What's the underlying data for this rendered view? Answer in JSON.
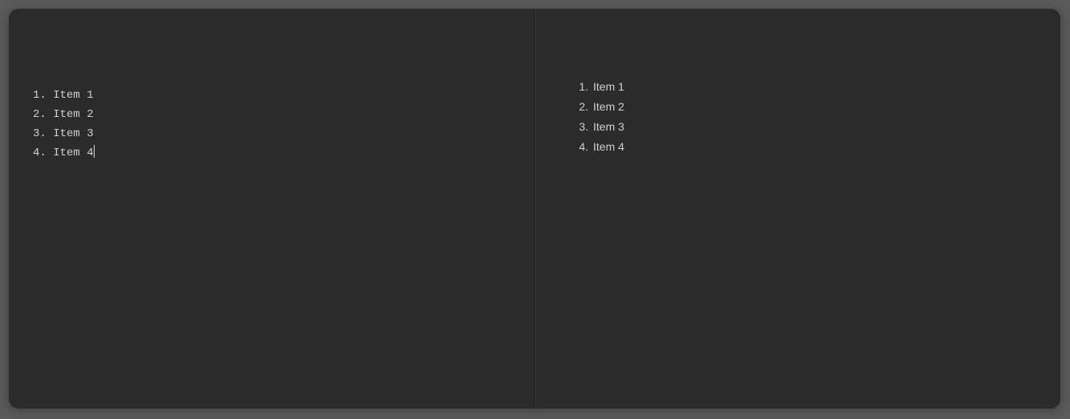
{
  "editor": {
    "lines": [
      {
        "number": "1",
        "text": "Item 1"
      },
      {
        "number": "2",
        "text": "Item 2"
      },
      {
        "number": "3",
        "text": "Item 3"
      },
      {
        "number": "4",
        "text": "Item 4"
      }
    ]
  },
  "preview": {
    "items": [
      "Item 1",
      "Item 2",
      "Item 3",
      "Item 4"
    ]
  }
}
